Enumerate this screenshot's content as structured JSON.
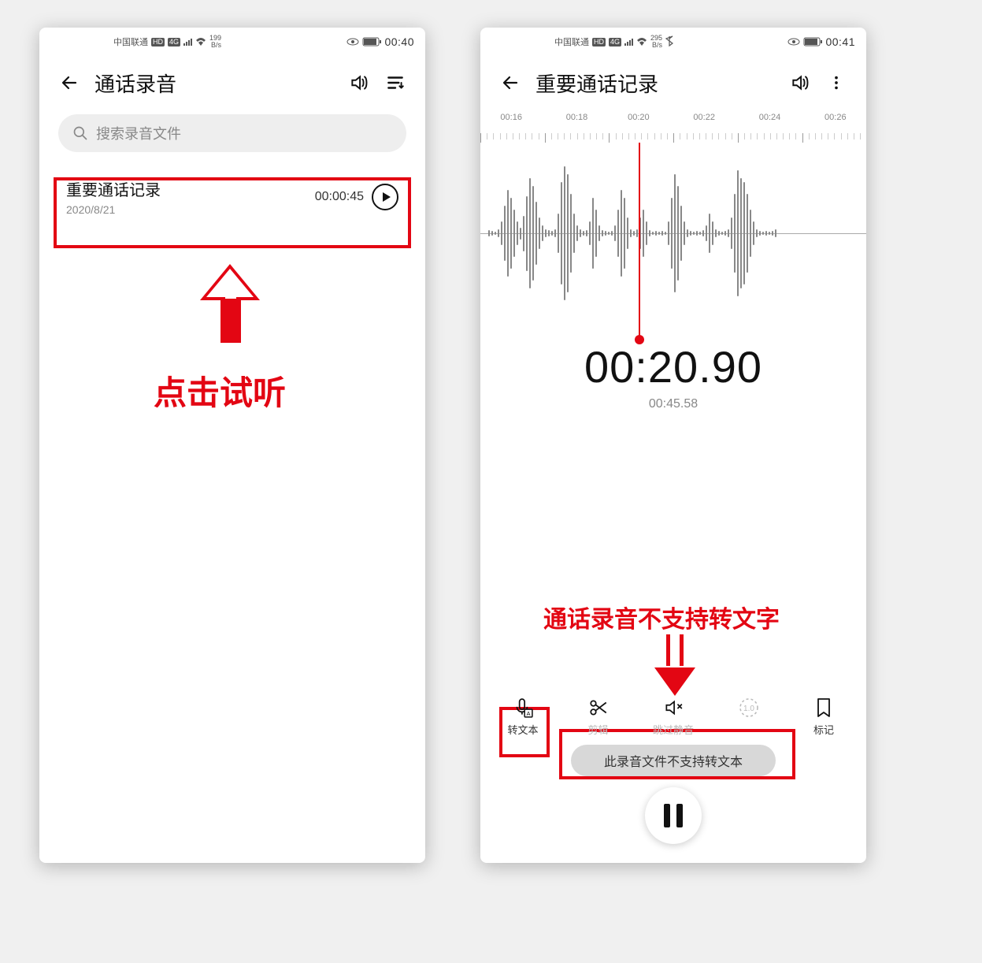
{
  "left": {
    "status": {
      "carrier": "中国联通",
      "hd": "HD",
      "net": "4G",
      "rate_top": "199",
      "rate_bottom": "B/s",
      "time": "00:40"
    },
    "header": {
      "title": "通话录音"
    },
    "search": {
      "placeholder": "搜索录音文件"
    },
    "recording": {
      "name": "重要通话记录",
      "date": "2020/8/21",
      "duration": "00:00:45"
    },
    "annotation_label": "点击试听"
  },
  "right": {
    "status": {
      "carrier": "中国联通",
      "hd": "HD",
      "net": "4G",
      "rate_top": "295",
      "rate_bottom": "B/s",
      "time": "00:41"
    },
    "header": {
      "title": "重要通话记录"
    },
    "timeline_ticks": [
      "00:16",
      "00:18",
      "00:20",
      "00:22",
      "00:24",
      "00:26"
    ],
    "current_time": "00:20.90",
    "total_time": "00:45.58",
    "annotation_label": "通话录音不支持转文字",
    "tools": {
      "to_text": "转文本",
      "trim": "剪辑",
      "mute": "跳过静音",
      "speed": "1.0",
      "bookmark": "标记"
    },
    "toast": "此录音文件不支持转文本"
  }
}
